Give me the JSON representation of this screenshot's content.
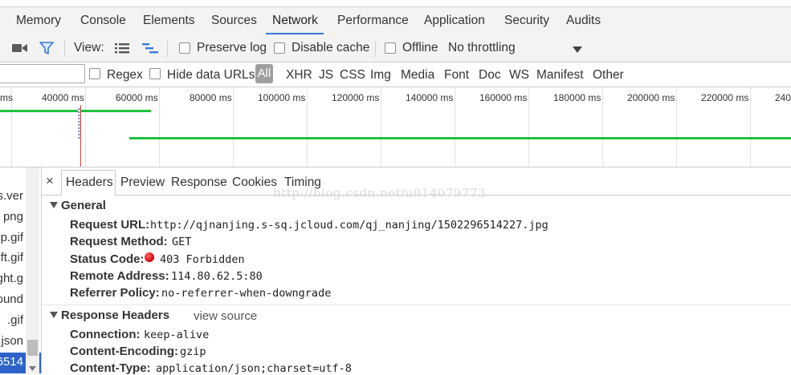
{
  "panel_tabs": [
    "Memory",
    "Console",
    "Elements",
    "Sources",
    "Network",
    "Performance",
    "Application",
    "Security",
    "Audits"
  ],
  "toolbar": {
    "view_label": "View:",
    "preserve_log": "Preserve log",
    "disable_cache": "Disable cache",
    "offline": "Offline",
    "throttling": "No throttling"
  },
  "filter": {
    "placeholder": "",
    "regex": "Regex",
    "hide_data_urls": "Hide data URLs",
    "types": [
      "All",
      "XHR",
      "JS",
      "CSS",
      "Img",
      "Media",
      "Font",
      "Doc",
      "WS",
      "Manifest",
      "Other"
    ]
  },
  "timeline": {
    "ticks": [
      "ms",
      "40000 ms",
      "60000 ms",
      "80000 ms",
      "100000 ms",
      "120000 ms",
      "140000 ms",
      "160000 ms",
      "180000 ms",
      "200000 ms",
      "220000 ms",
      "240"
    ],
    "colors": {
      "download": "#1ec43c",
      "marker": "#e0413a",
      "requests": "#7aa4d6"
    }
  },
  "request_list": [
    "s.ver",
    "png",
    "pp.gif",
    "ft.gif",
    "ght.g",
    "ound",
    ".gif",
    ".json",
    "6514"
  ],
  "detail": {
    "close_glyph": "×",
    "tabs": [
      "Headers",
      "Preview",
      "Response",
      "Cookies",
      "Timing"
    ],
    "watermark": "http://blog.csdn.net/u014079773",
    "general": {
      "title": "General",
      "rows": [
        {
          "name": "Request URL:",
          "value": "http://qjnanjing.s-sq.jcloud.com/qj_nanjing/1502296514227.jpg"
        },
        {
          "name": "Request Method:",
          "value": "GET"
        },
        {
          "name": "Status Code:",
          "value": "403 Forbidden"
        },
        {
          "name": "Remote Address:",
          "value": "114.80.62.5:80"
        },
        {
          "name": "Referrer Policy:",
          "value": "no-referrer-when-downgrade"
        }
      ]
    },
    "response_headers": {
      "title": "Response Headers",
      "view_source": "view source",
      "rows": [
        {
          "name": "Connection:",
          "value": "keep-alive"
        },
        {
          "name": "Content-Encoding:",
          "value": "gzip"
        },
        {
          "name": "Content-Type:",
          "value": "application/json;charset=utf-8"
        }
      ]
    }
  },
  "colors": {
    "accent": "#3879d9",
    "status_error": "#d40000",
    "selected_row": "#2d63c8",
    "all_chip": "#9e9e9e"
  }
}
